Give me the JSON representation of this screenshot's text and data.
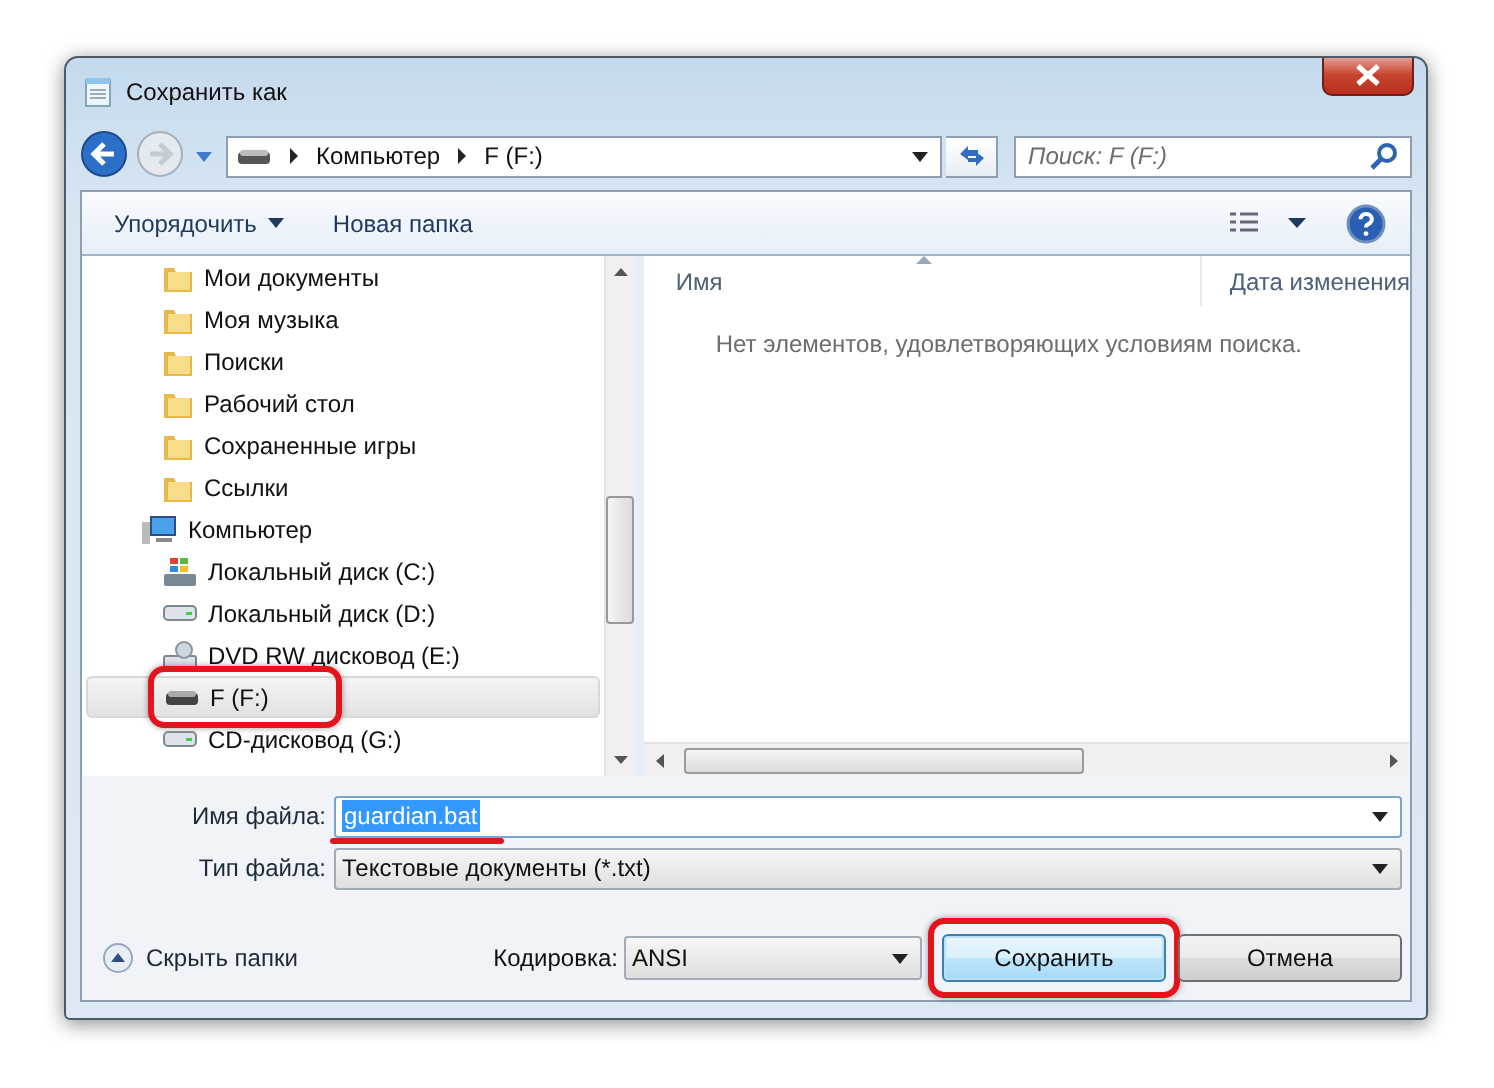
{
  "window": {
    "title": "Сохранить как"
  },
  "address": {
    "path": [
      "Компьютер",
      "F (F:)"
    ]
  },
  "search": {
    "placeholder": "Поиск: F (F:)"
  },
  "toolbar": {
    "organize": "Упорядочить",
    "new_folder": "Новая папка"
  },
  "tree": [
    {
      "label": "Мои документы",
      "kind": "folder",
      "selected": false
    },
    {
      "label": "Моя музыка",
      "kind": "folder",
      "selected": false
    },
    {
      "label": "Поиски",
      "kind": "folder",
      "selected": false
    },
    {
      "label": "Рабочий стол",
      "kind": "folder",
      "selected": false
    },
    {
      "label": "Сохраненные игры",
      "kind": "folder",
      "selected": false
    },
    {
      "label": "Ссылки",
      "kind": "folder",
      "selected": false
    },
    {
      "label": "Компьютер",
      "kind": "computer",
      "selected": false,
      "children": [
        {
          "label": "Локальный диск (C:)",
          "kind": "system-drive",
          "selected": false
        },
        {
          "label": "Локальный диск (D:)",
          "kind": "drive",
          "selected": false
        },
        {
          "label": "DVD RW дисковод (E:)",
          "kind": "dvd-drive",
          "selected": false
        },
        {
          "label": "F (F:)",
          "kind": "usb-drive",
          "selected": true,
          "highlighted": true
        },
        {
          "label": "CD-дисковод (G:)",
          "kind": "drive",
          "selected": false
        }
      ]
    }
  ],
  "file_list": {
    "columns": [
      "Имя",
      "Дата изменения"
    ],
    "empty_message": "Нет элементов, удовлетворяющих условиям поиска."
  },
  "filename": {
    "label": "Имя файла:",
    "value": "guardian.bat",
    "text_selected": true,
    "underlined": true
  },
  "filetype": {
    "label": "Тип файла:",
    "value": "Текстовые документы (*.txt)"
  },
  "hide_folders": "Скрыть папки",
  "encoding": {
    "label": "Кодировка:",
    "value": "ANSI"
  },
  "buttons": [
    {
      "label": "Сохранить",
      "default": true,
      "highlighted": true
    },
    {
      "label": "Отмена",
      "default": false,
      "highlighted": false
    }
  ]
}
